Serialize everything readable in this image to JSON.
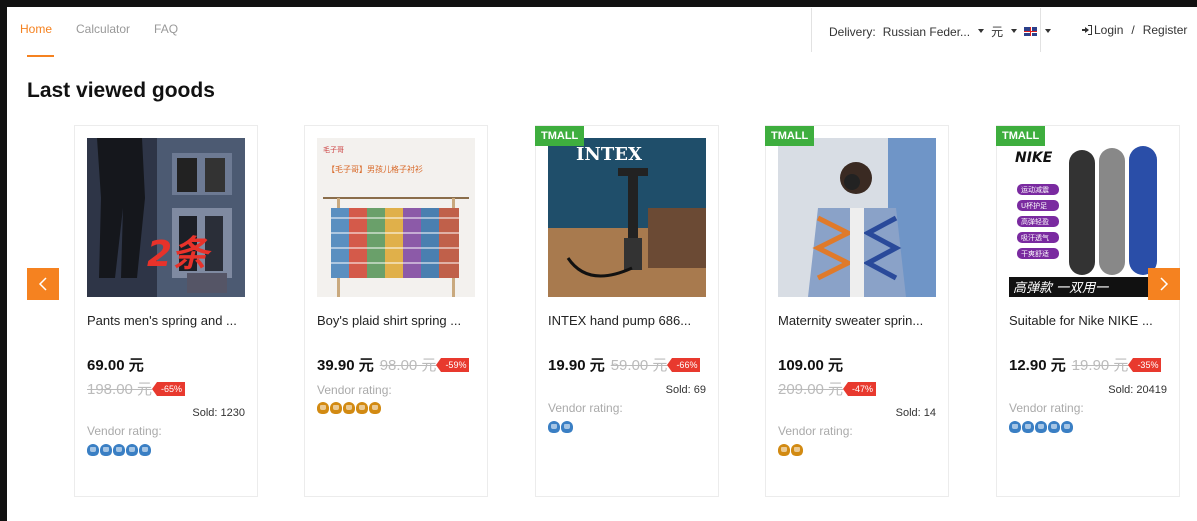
{
  "nav": {
    "items": [
      {
        "label": "Home",
        "active": true
      },
      {
        "label": "Calculator",
        "active": false
      },
      {
        "label": "FAQ",
        "active": false
      }
    ]
  },
  "header": {
    "delivery_label": "Delivery:",
    "delivery_country": "Russian Feder...",
    "currency": "元",
    "language_flag": "uk-flag-icon",
    "login": "Login",
    "separator": "/",
    "register": "Register"
  },
  "section": {
    "title": "Last viewed goods"
  },
  "products": [
    {
      "title": "Pants men's spring and ...",
      "badge": "",
      "price": "69.00 元",
      "old_price": "198.00 元",
      "discount": "-65%",
      "sold": "Sold: 1230",
      "vendor_label": "Vendor rating:",
      "rating_icon": "crown-blue",
      "rating_count": 5
    },
    {
      "title": "Boy's plaid shirt spring ...",
      "badge": "",
      "price": "39.90 元",
      "old_price": "98.00 元",
      "discount": "-59%",
      "sold": "",
      "vendor_label": "Vendor rating:",
      "rating_icon": "crown-gold",
      "rating_count": 5
    },
    {
      "title": "INTEX hand pump 686...",
      "badge": "TMALL",
      "price": "19.90 元",
      "old_price": "59.00 元",
      "discount": "-66%",
      "sold": "Sold: 69",
      "vendor_label": "Vendor rating:",
      "rating_icon": "crown-blue",
      "rating_count": 2
    },
    {
      "title": "Maternity sweater sprin...",
      "badge": "TMALL",
      "price": "109.00 元",
      "old_price": "209.00 元",
      "discount": "-47%",
      "sold": "Sold: 14",
      "vendor_label": "Vendor rating:",
      "rating_icon": "crown-gold",
      "rating_count": 2
    },
    {
      "title": "Suitable for Nike NIKE ...",
      "badge": "TMALL",
      "price": "12.90 元",
      "old_price": "19.90 元",
      "discount": "-35%",
      "sold": "Sold: 20419",
      "vendor_label": "Vendor rating:",
      "rating_icon": "crown-blue",
      "rating_count": 5
    }
  ],
  "image_text": {
    "pants": "2条",
    "shirt_banner": "【毛子哥】男孩儿格子衬衫",
    "intex_logo": "INTEX",
    "nike_logo": "NIKE",
    "insole_banner": "高弹款 一双用一",
    "insole_tags": [
      "运动减震",
      "U杯护足",
      "高弹轻盈",
      "吸汗透气",
      "干爽舒适"
    ]
  },
  "carousel": {
    "prev_icon": "chevron-left-icon",
    "next_icon": "chevron-right-icon"
  }
}
